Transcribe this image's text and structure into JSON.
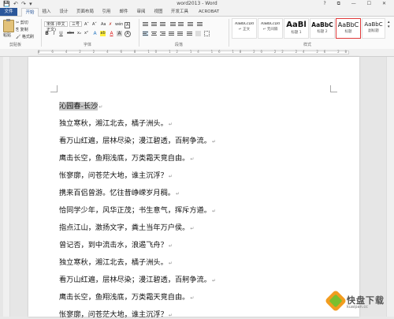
{
  "titlebar": {
    "qat": "💾 ↶ ↷ ▾",
    "title": "word2013 - Word",
    "controls": "? ⧉ — ☐ ✕"
  },
  "tabs": [
    "文件",
    "开始",
    "插入",
    "设计",
    "页面布局",
    "引用",
    "邮件",
    "审阅",
    "视图",
    "开发工具",
    "ACROBAT"
  ],
  "ribbon": {
    "clipboard": {
      "paste": "粘贴",
      "cut": "✂ 剪切",
      "copy": "⎘ 复制",
      "painter": "🖌 格式刷",
      "label": "剪贴板"
    },
    "font": {
      "name": "宋体 (中文正文)",
      "size": "三号",
      "grow": "A˄",
      "shrink": "A˅",
      "aa": "Aa",
      "clear": "✗",
      "wen": "wén",
      "ab": "A",
      "bold": "B",
      "italic": "I",
      "underline": "U",
      "strike": "abc",
      "sub": "x₂",
      "sup": "x²",
      "effects": "A",
      "highlight": "ab",
      "color": "A",
      "charshade": "A",
      "enc": "A",
      "label": "字体"
    },
    "paragraph": {
      "label": "段落"
    },
    "styles": {
      "items": [
        {
          "sample": "AaBbCcDd",
          "name": "↵ 正文"
        },
        {
          "sample": "AaBbCcDd",
          "name": "↵ 无间隔"
        },
        {
          "sample": "AaBl",
          "name": "标题 1"
        },
        {
          "sample": "AaBbC",
          "name": "标题 2"
        },
        {
          "sample": "AaBbC",
          "name": "标题"
        },
        {
          "sample": "AaBbC",
          "name": "副标题"
        }
      ],
      "label": "样式"
    }
  },
  "ruler": {
    "numbers": "8 6 4 2 2 4 6 8 10 12 14 16 18 20 22 24 26 28 30 32 34 36 38 40 42 44 46 48"
  },
  "document": {
    "mark": "↵",
    "lines": [
      "沁园春-长沙",
      "独立寒秋，湘江北去，橘子洲头。",
      "看万山红遍，层林尽染；漫江碧透，百舸争流。",
      "鹰击长空，鱼翔浅底，万类霜天竞自由。",
      "怅寥廓，问苍茫大地，谁主沉浮？",
      "携来百侣曾游。忆往昔峥嵘岁月稠。",
      "恰同学少年，风华正茂；书生意气，挥斥方遒。",
      "指点江山，激扬文字，粪土当年万户侯。",
      "曾记否，到中流击水，浪遏飞舟？",
      "独立寒秋，湘江北去，橘子洲头。",
      "看万山红遍，层林尽染；漫江碧透，百舸争流。",
      "鹰击长空，鱼翔浅底，万类霜天竞自由。",
      "怅寥廓，问苍茫大地，谁主沉浮？"
    ]
  },
  "watermark": {
    "brand": "快盘下载",
    "sub": "kuaipan.cc"
  },
  "colors": {
    "accent": "#2b579a",
    "selected_style_border": "#e03b3b",
    "highlight": "#c9c9c9"
  }
}
